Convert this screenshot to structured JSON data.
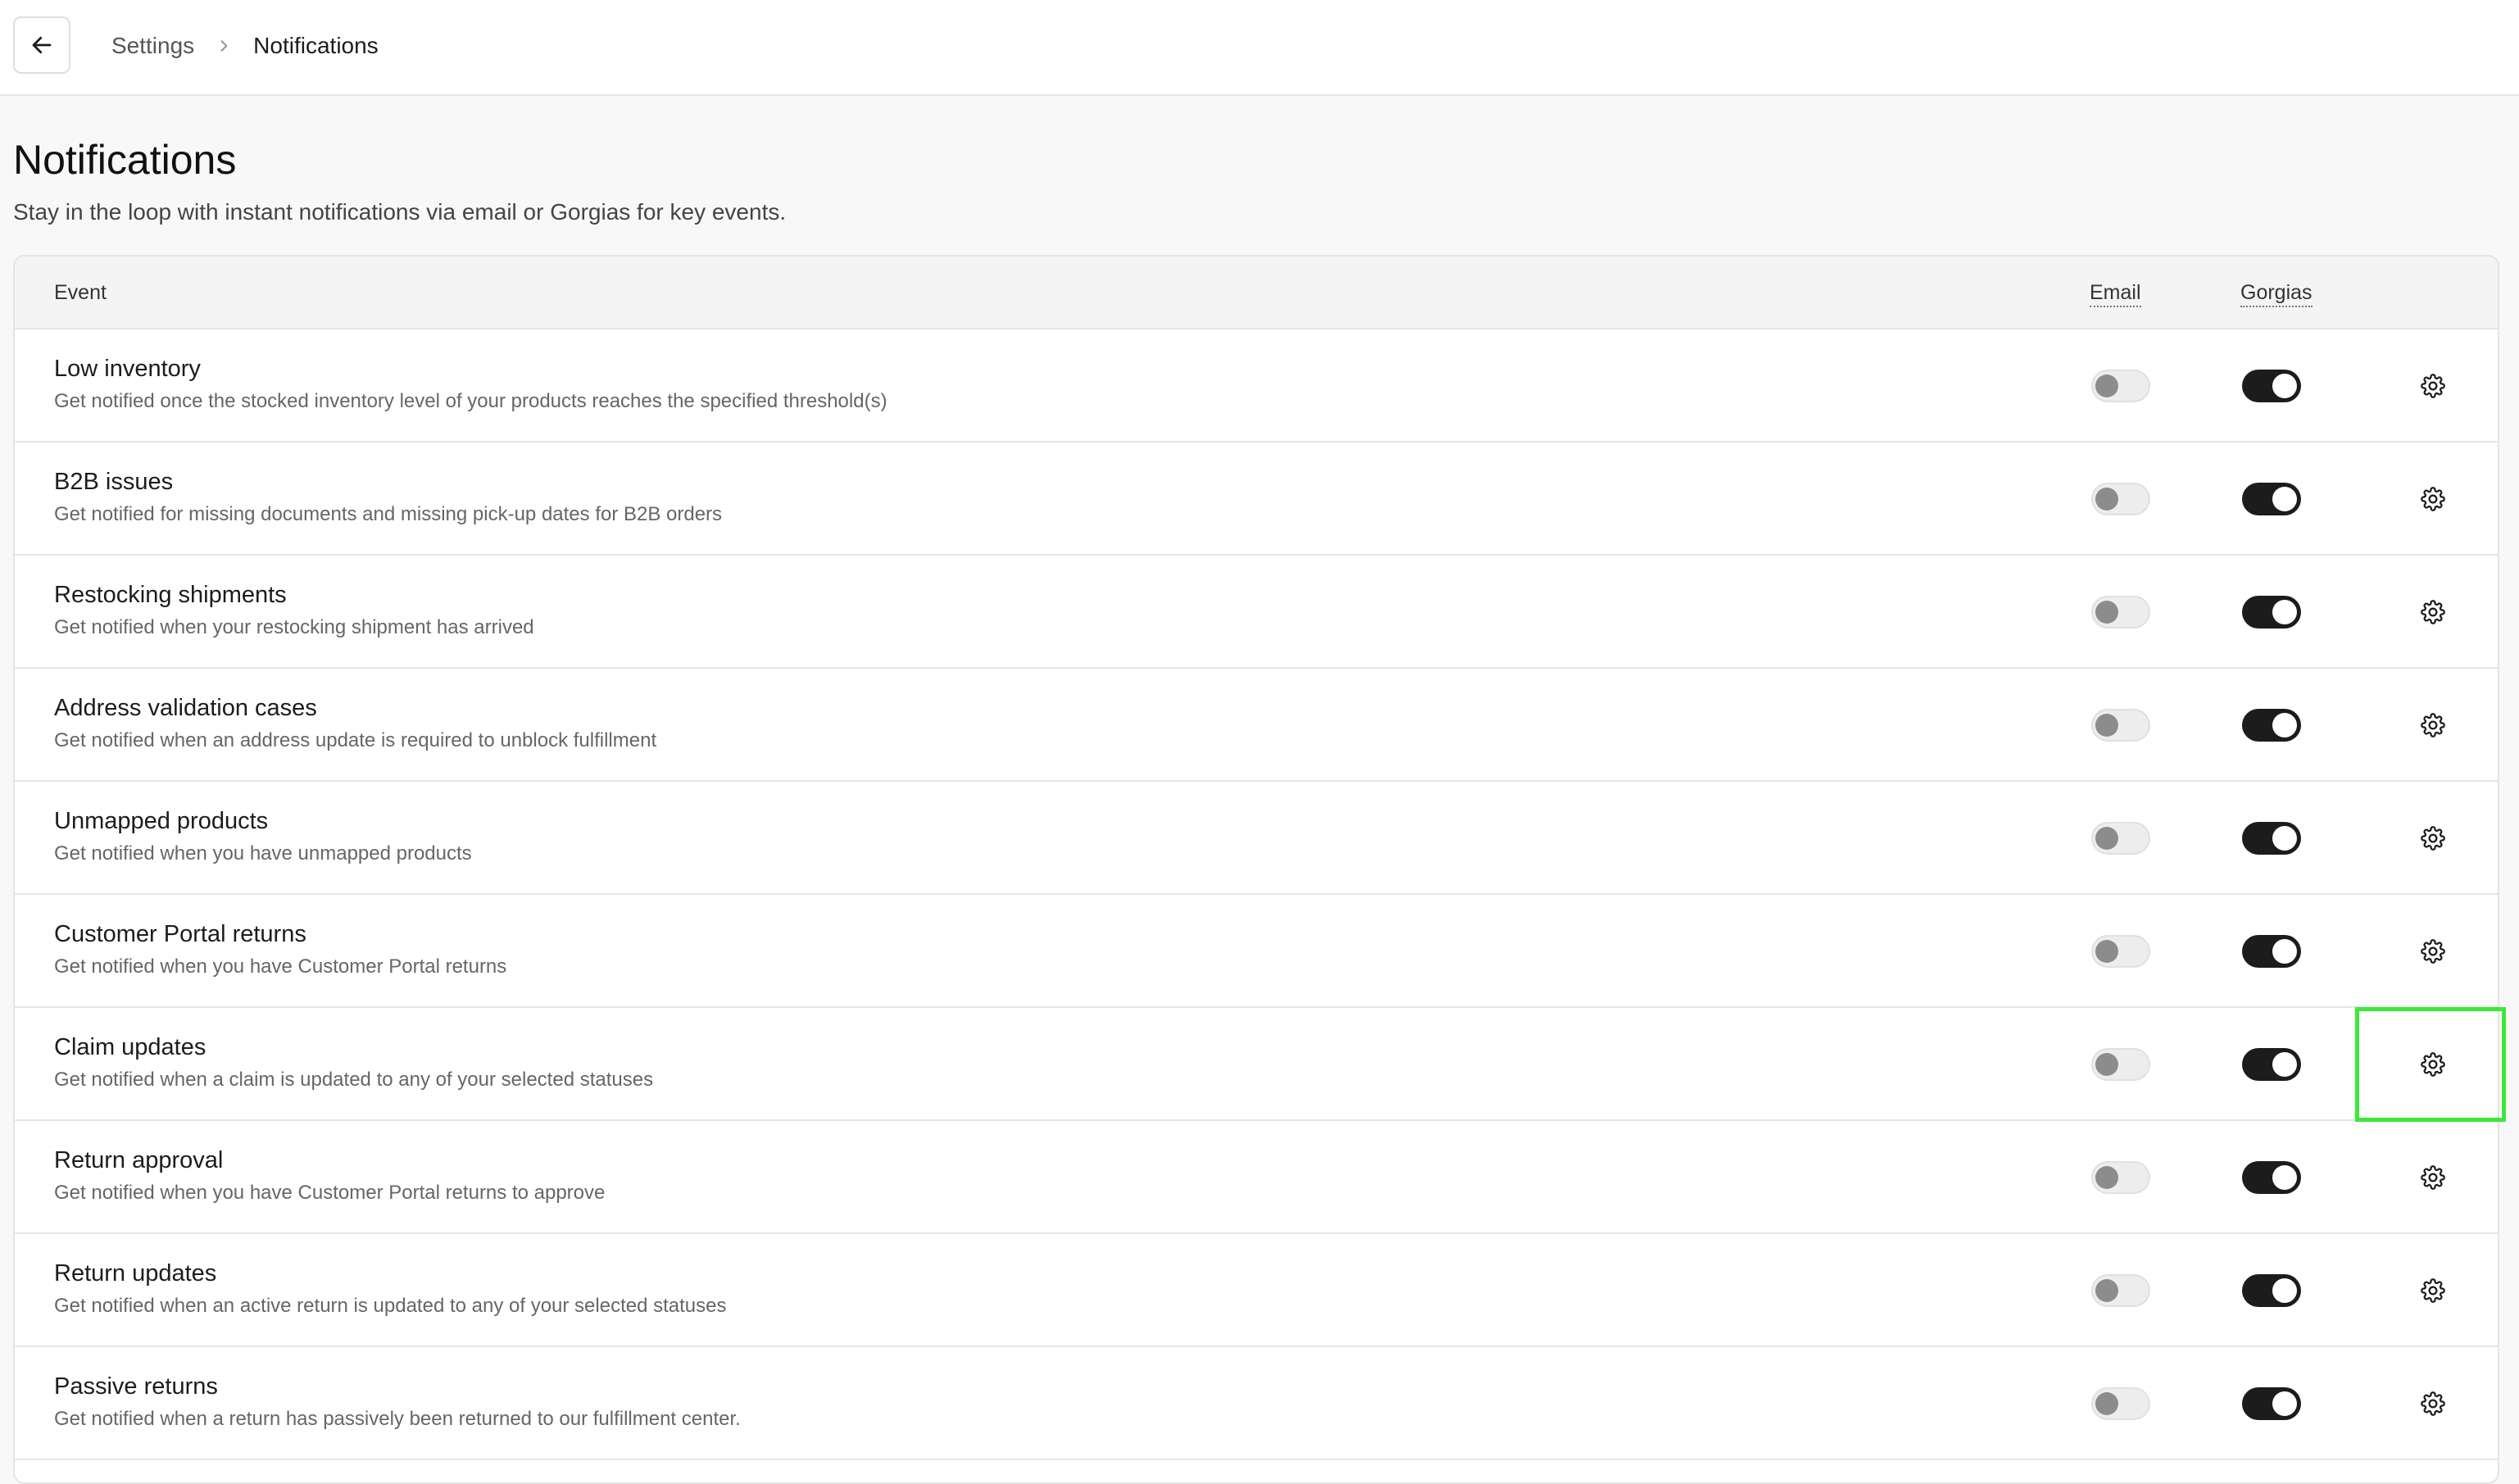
{
  "breadcrumb": {
    "back_icon": "arrow-left-icon",
    "parent": "Settings",
    "separator_icon": "chevron-right-icon",
    "current": "Notifications"
  },
  "page": {
    "title": "Notifications",
    "subtitle": "Stay in the loop with instant notifications via email or Gorgias for key events."
  },
  "table": {
    "columns": {
      "event": "Event",
      "email": "Email",
      "gorgias": "Gorgias"
    },
    "rows": [
      {
        "title": "Low inventory",
        "description": "Get notified once the stocked inventory level of your products reaches the specified threshold(s)",
        "email_enabled": false,
        "gorgias_enabled": true
      },
      {
        "title": "B2B issues",
        "description": "Get notified for missing documents and missing pick-up dates for B2B orders",
        "email_enabled": false,
        "gorgias_enabled": true
      },
      {
        "title": "Restocking shipments",
        "description": "Get notified when your restocking shipment has arrived",
        "email_enabled": false,
        "gorgias_enabled": true
      },
      {
        "title": "Address validation cases",
        "description": "Get notified when an address update is required to unblock fulfillment",
        "email_enabled": false,
        "gorgias_enabled": true
      },
      {
        "title": "Unmapped products",
        "description": "Get notified when you have unmapped products",
        "email_enabled": false,
        "gorgias_enabled": true
      },
      {
        "title": "Customer Portal returns",
        "description": "Get notified when you have Customer Portal returns",
        "email_enabled": false,
        "gorgias_enabled": true
      },
      {
        "title": "Claim updates",
        "description": "Get notified when a claim is updated to any of your selected statuses",
        "email_enabled": false,
        "gorgias_enabled": true
      },
      {
        "title": "Return approval",
        "description": "Get notified when you have Customer Portal returns to approve",
        "email_enabled": false,
        "gorgias_enabled": true
      },
      {
        "title": "Return updates",
        "description": "Get notified when an active return is updated to any of your selected statuses",
        "email_enabled": false,
        "gorgias_enabled": true
      },
      {
        "title": "Passive returns",
        "description": "Get notified when a return has passively been returned to our fulfillment center.",
        "email_enabled": false,
        "gorgias_enabled": true
      }
    ],
    "settings_icon": "gear-icon"
  },
  "colors": {
    "toggle_on": "#1c1c1c",
    "toggle_off": "#ededed",
    "highlight": "#3ee83a"
  }
}
